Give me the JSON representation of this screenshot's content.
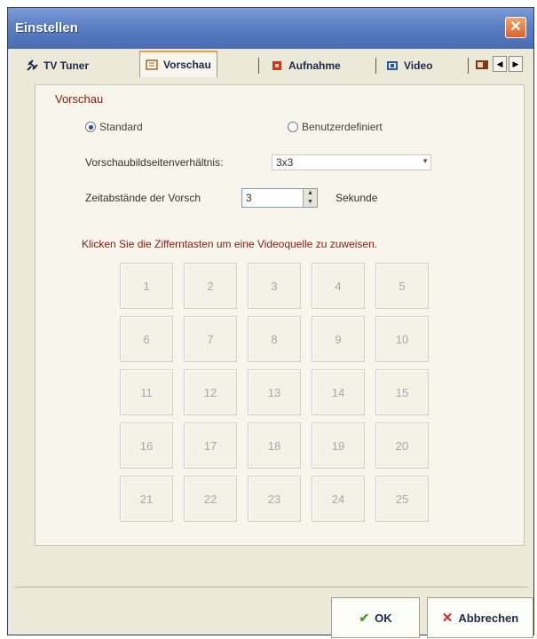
{
  "window": {
    "title": "Einstellen"
  },
  "tabs": [
    {
      "label": "TV Tuner",
      "icon": "satellite-icon"
    },
    {
      "label": "Vorschau",
      "icon": "preview-icon"
    },
    {
      "label": "Aufnahme",
      "icon": "record-icon"
    },
    {
      "label": "Video",
      "icon": "video-icon"
    }
  ],
  "preview": {
    "section_title": "Vorschau",
    "radio_standard": "Standard",
    "radio_custom": "Benutzerdefiniert",
    "ratio_label": "Vorschaubildseitenverhältnis:",
    "ratio_value": "3x3",
    "interval_label": "Zeitabstände der Vorsch",
    "interval_value": "3",
    "interval_unit": "Sekunde",
    "hint": "Klicken Sie die Zifferntasten um eine Videoquelle zu zuweisen."
  },
  "grid": [
    "1",
    "2",
    "3",
    "4",
    "5",
    "6",
    "7",
    "8",
    "9",
    "10",
    "11",
    "12",
    "13",
    "14",
    "15",
    "16",
    "17",
    "18",
    "19",
    "20",
    "21",
    "22",
    "23",
    "24",
    "25"
  ],
  "buttons": {
    "ok": "OK",
    "cancel": "Abbrechen"
  }
}
